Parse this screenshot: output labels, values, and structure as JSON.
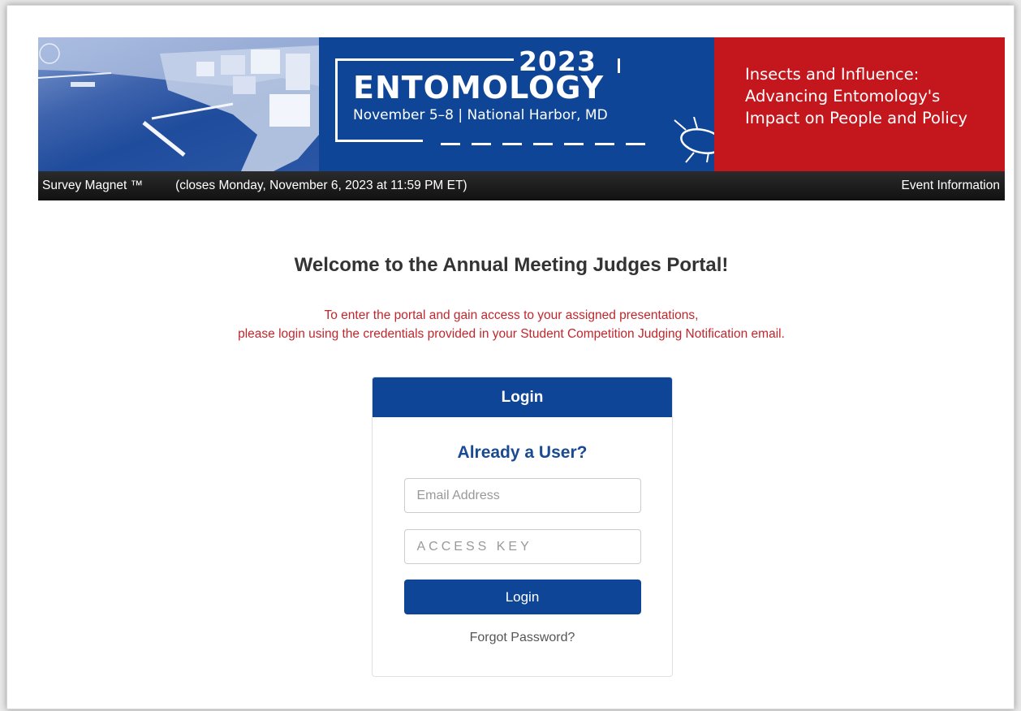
{
  "banner": {
    "year": "2023",
    "event_name": "ENTOMOLOGY",
    "dates_location": "November 5–8 | National Harbor, MD",
    "tagline_line1": "Insects and Influence:",
    "tagline_line2": "Advancing Entomology's",
    "tagline_line3": "Impact on People and Policy"
  },
  "navbar": {
    "brand": "Survey Magnet ™",
    "closes": "(closes Monday, November 6, 2023 at 11:59 PM ET)",
    "event_info": "Event Information"
  },
  "main": {
    "welcome": "Welcome to the Annual Meeting Judges Portal!",
    "instructions_line1": "To enter the portal and gain access to your assigned presentations,",
    "instructions_line2": "please login using the credentials provided in your Student Competition Judging Notification email."
  },
  "login": {
    "header": "Login",
    "subtitle": "Already a User?",
    "email_placeholder": "Email Address",
    "email_value": "",
    "key_placeholder": "ACCESS KEY",
    "key_value": "",
    "button_label": "Login",
    "forgot_label": "Forgot Password?"
  },
  "colors": {
    "brand_blue": "#0f4597",
    "brand_red": "#c4171d",
    "instruction_red": "#c0272d"
  }
}
